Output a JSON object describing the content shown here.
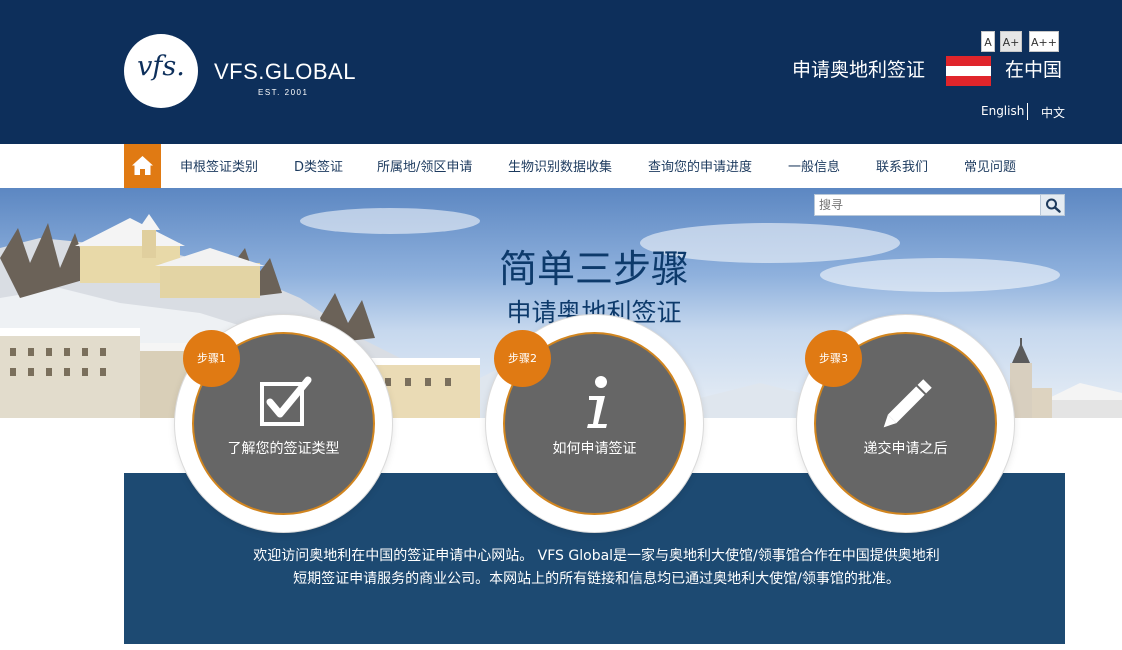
{
  "header": {
    "logo_mark": "vfs.",
    "brand_name": "VFS.GLOBAL",
    "brand_est": "EST. 2001",
    "font_sizes": [
      "A",
      "A+",
      "A++"
    ],
    "apply_title": "申请奥地利签证",
    "in_country": "在中国",
    "flag_colors": [
      "#e0252b",
      "#ffffff",
      "#e0252b"
    ],
    "languages": {
      "english": "English",
      "chinese": "中文"
    }
  },
  "nav": {
    "home_icon": "home-icon",
    "items": [
      "申根签证类别",
      "D类签证",
      "所属地/领区申请",
      "生物识别数据收集",
      "查询您的申请进度",
      "一般信息",
      "联系我们",
      "常见问题"
    ],
    "accent": "#e07a13"
  },
  "search": {
    "placeholder": "搜寻",
    "icon": "search-icon"
  },
  "hero": {
    "title": "简单三步骤",
    "subtitle": "申请奥地利签证"
  },
  "steps": [
    {
      "badge": "步骤1",
      "label": "了解您的签证类型",
      "icon": "checkbox-icon"
    },
    {
      "badge": "步骤2",
      "label": "如何申请签证",
      "icon": "info-icon"
    },
    {
      "badge": "步骤3",
      "label": "递交申请之后",
      "icon": "pencil-icon"
    }
  ],
  "panel": {
    "line1": "欢迎访问奥地利在中国的签证申请中心网站。 VFS Global是一家与奥地利大使馆/领事馆合作在中国提供奥地利",
    "line2": "短期签证申请服务的商业公司。本网站上的所有链接和信息均已通过奥地利大使馆/领事馆的批准。"
  },
  "colors": {
    "header_bg": "#0d2f5b",
    "panel_bg": "#1d4a72",
    "step_gray": "#666666"
  }
}
